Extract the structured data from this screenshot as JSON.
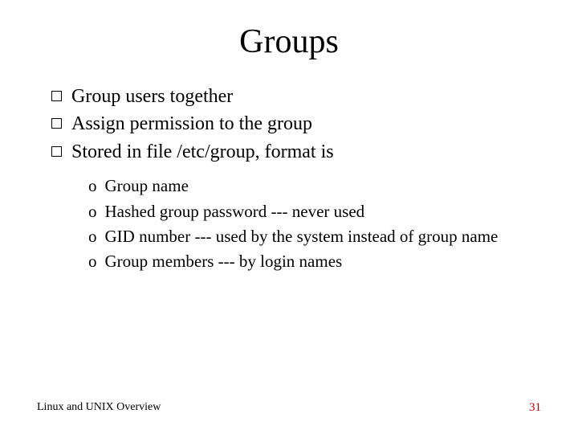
{
  "title": "Groups",
  "bullets": [
    "Group users together",
    "Assign permission to the group",
    "Stored in file /etc/group, format is"
  ],
  "subbullets": [
    "Group name",
    "Hashed group password --- never used",
    "GID number --- used by the system instead of group name",
    "Group members --- by login names"
  ],
  "footer": {
    "left": "Linux and UNIX Overview",
    "page": "31"
  },
  "sub_marker": "o"
}
